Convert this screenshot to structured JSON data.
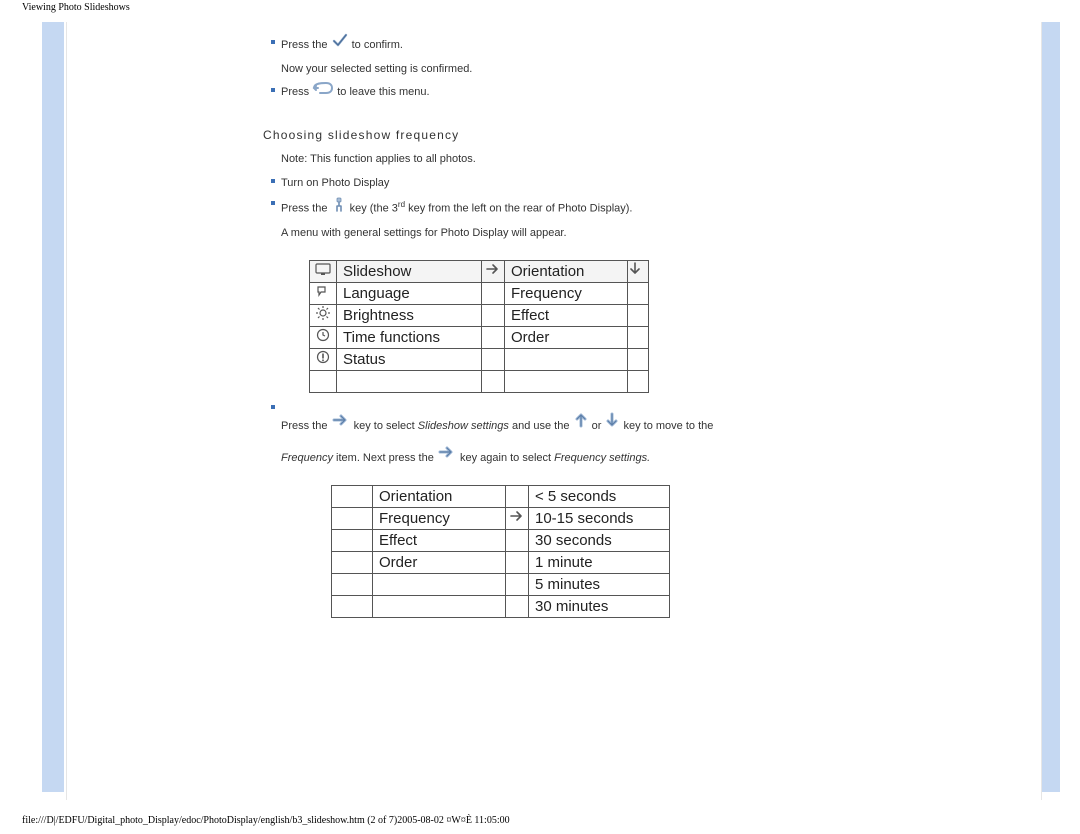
{
  "header_title": "Viewing Photo Slideshows",
  "footer_text": "file:///D|/EDFU/Digital_photo_Display/edoc/PhotoDisplay/english/b3_slideshow.htm (2 of 7)2005-08-02 ¤W¤È 11:05:00",
  "intro": {
    "line1a": "Press the ",
    "line1b": " to confirm.",
    "line2": "Now your selected setting is confirmed.",
    "line3a": "Press ",
    "line3b": " to leave this menu."
  },
  "heading": "Choosing slideshow frequency",
  "body": {
    "note": "Note: This function applies to all photos.",
    "turn_on": "Turn on Photo Display",
    "press_key_a": "Press the ",
    "press_key_b": " key (the 3",
    "press_key_sup": "rd",
    "press_key_c": " key from the left on the rear of Photo Display).",
    "menu_appear": "A menu with general settings for Photo Display will appear."
  },
  "menu1": {
    "r1c1": "Slideshow",
    "r1c2": "Orientation",
    "r2c1": "Language",
    "r2c2": "Frequency",
    "r3c1": "Brightness",
    "r3c2": "Effect",
    "r4c1": "Time functions",
    "r4c2": "Order",
    "r5c1": "Status"
  },
  "instr2": {
    "a": "Press the",
    "b": " key to select ",
    "i1": "Slideshow settings",
    "c": " and use the ",
    "d": " or ",
    "e": " key to move to the",
    "line2a": "Frequency",
    "line2b": " item.  Next press the",
    "line2c": " key again to select ",
    "line2d": "Frequency settings."
  },
  "menu2": {
    "r1c1": "Orientation",
    "r1c2": "< 5 seconds",
    "r2c1": "Frequency",
    "r2c2": "10-15 seconds",
    "r3c1": "Effect",
    "r3c2": "30 seconds",
    "r4c1": "Order",
    "r4c2": "1 minute",
    "r5c2": "5 minutes",
    "r6c2": "30 minutes"
  }
}
